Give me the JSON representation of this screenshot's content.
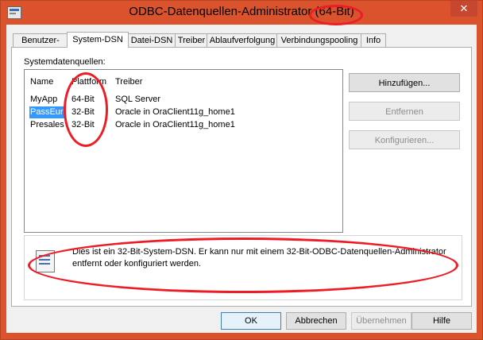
{
  "window": {
    "title": "ODBC-Datenquellen-Administrator (64-Bit)",
    "close_label": "✕"
  },
  "tabs": [
    {
      "label": "Benutzer-DSN"
    },
    {
      "label": "System-DSN"
    },
    {
      "label": "Datei-DSN"
    },
    {
      "label": "Treiber"
    },
    {
      "label": "Ablaufverfolgung"
    },
    {
      "label": "Verbindungspooling"
    },
    {
      "label": "Info"
    }
  ],
  "active_tab": "System-DSN",
  "system_dsn": {
    "group_label": "Systemdatenquellen:",
    "columns": {
      "name": "Name",
      "platform": "Plattform",
      "driver": "Treiber"
    },
    "rows": [
      {
        "name": "MyApp",
        "platform": "64-Bit",
        "driver": "SQL Server",
        "selected": false
      },
      {
        "name": "PassEur",
        "platform": "32-Bit",
        "driver": "Oracle in OraClient11g_home1",
        "selected": true
      },
      {
        "name": "Presales",
        "platform": "32-Bit",
        "driver": "Oracle in OraClient11g_home1",
        "selected": false
      }
    ],
    "buttons": {
      "add": "Hinzufügen...",
      "remove": "Entfernen",
      "configure": "Konfigurieren..."
    },
    "info_text": "Dies ist ein 32-Bit-System-DSN. Er kann nur mit einem 32-Bit-ODBC-Datenquellen-Administrator entfernt oder konfiguriert werden."
  },
  "footer": {
    "ok": "OK",
    "cancel": "Abbrechen",
    "apply": "Übernehmen",
    "help": "Hilfe"
  },
  "annotation_color": "#ee1c25",
  "icons": {
    "app": "odbc-icon",
    "info": "document-info-icon",
    "close": "close-icon"
  }
}
